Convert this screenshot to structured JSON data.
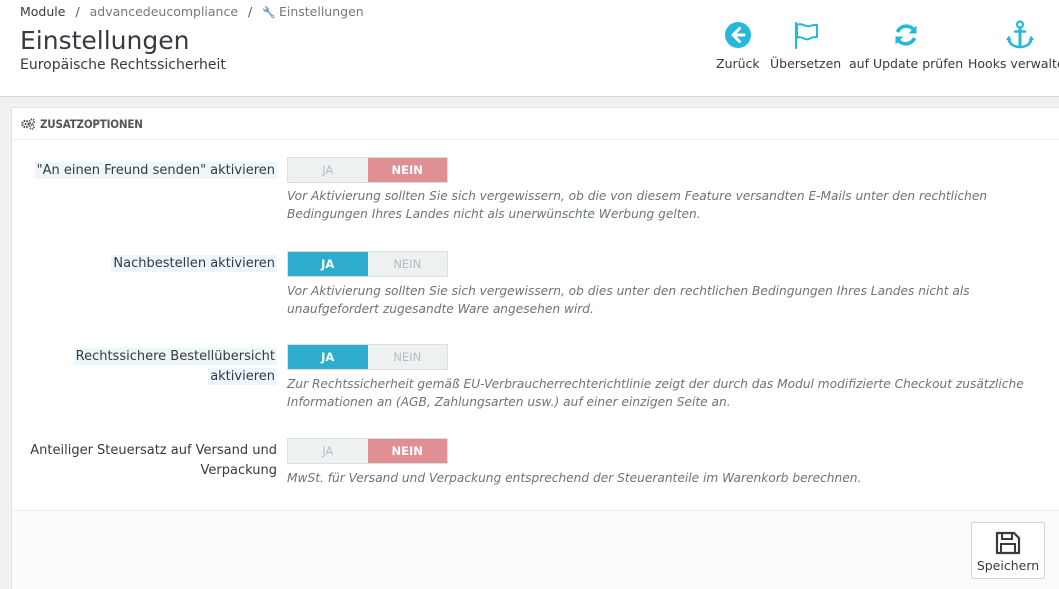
{
  "breadcrumb": {
    "items": [
      "Module",
      "advancedeucompliance",
      "Einstellungen"
    ],
    "separator": "/"
  },
  "header": {
    "title": "Einstellungen",
    "subtitle": "Europäische Rechtssicherheit"
  },
  "toolbar": {
    "back_label": "Zurück",
    "translate_label": "Übersetzen",
    "update_label": "auf Update prüfen",
    "hooks_label": "Hooks verwalten",
    "accent_color": "#25b9d7"
  },
  "panel": {
    "heading": "ZUSATZOPTIONEN",
    "switch_yes": "JA",
    "switch_no": "NEIN",
    "options": [
      {
        "label": "\"An einen Freund senden\" aktivieren",
        "value": "NEIN",
        "help": "Vor Aktivierung sollten Sie sich vergewissern, ob die von diesem Feature versandten E-Mails unter den rechtlichen Bedingungen Ihres Landes nicht als unerwünschte Werbung gelten."
      },
      {
        "label": "Nachbestellen aktivieren",
        "value": "JA",
        "help": "Vor Aktivierung sollten Sie sich vergewissern, ob dies unter den rechtlichen Bedingungen Ihres Landes nicht als unaufgefordert zugesandte Ware angesehen wird."
      },
      {
        "label_line1": "Rechtssichere Bestellübersicht",
        "label_line2": "aktivieren",
        "value": "JA",
        "help": "Zur Rechtssicherheit gemäß EU-Verbraucherrechterichtlinie zeigt der durch das Modul modifizierte Checkout zusätzliche Informationen an (AGB, Zahlungsarten usw.) auf einer einzigen Seite an."
      },
      {
        "label_line1": "Anteiliger Steuersatz auf Versand und",
        "label_line2": "Verpackung",
        "value": "NEIN",
        "help": "MwSt. für Versand und Verpackung entsprechend der Steueranteile im Warenkorb berechnen."
      }
    ],
    "colors": {
      "yes_active": "#2eacce",
      "no_active": "#e08f95"
    },
    "save_label": "Speichern"
  }
}
